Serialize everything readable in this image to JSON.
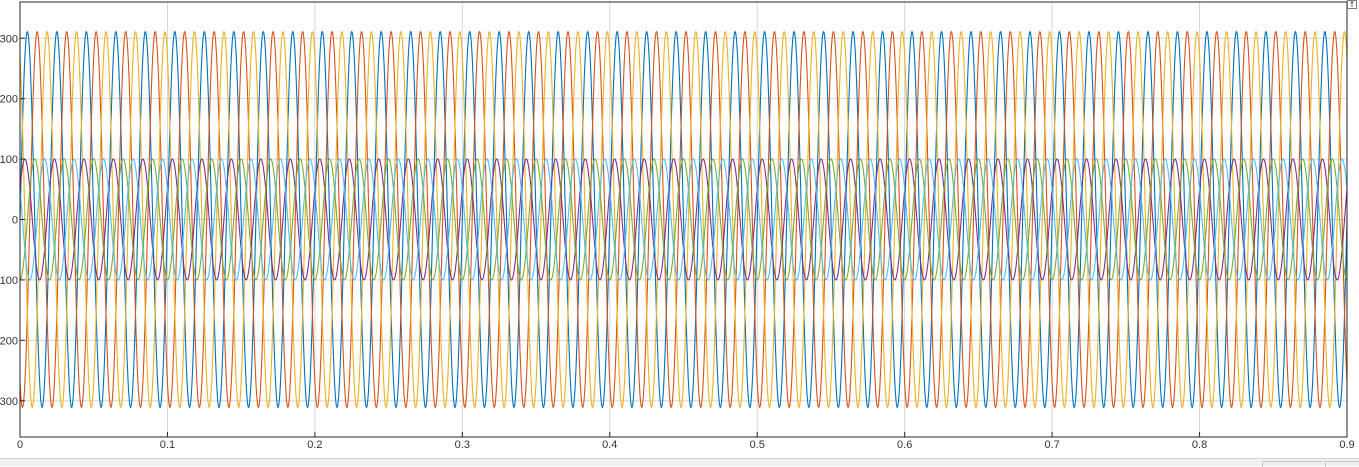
{
  "icons": {
    "axes_restore": "arrow-up-icon"
  },
  "colors": {
    "background": "#ffffff",
    "axes_border": "#262626",
    "grid": "#d6d6d6",
    "tick_label": "#333333"
  },
  "chart_data": {
    "type": "line",
    "title": "",
    "xlabel": "",
    "ylabel": "",
    "xlim": [
      0,
      0.9
    ],
    "ylim": [
      -360,
      360
    ],
    "grid": true,
    "legend": "none",
    "x_ticks": [
      "0",
      "0.1",
      "0.2",
      "0.3",
      "0.4",
      "0.5",
      "0.6",
      "0.7",
      "0.8",
      "0.9"
    ],
    "y_ticks": [
      "300",
      "200",
      "100",
      "0",
      "100",
      "200",
      "300"
    ],
    "y_tick_values": [
      300,
      200,
      100,
      0,
      -100,
      -200,
      -300
    ],
    "frequency_hz": 50,
    "series": [
      {
        "color": "#0072bd",
        "amplitude": 311,
        "phase_deg": 0
      },
      {
        "color": "#d95319",
        "amplitude": 311,
        "phase_deg": -120
      },
      {
        "color": "#edb120",
        "amplitude": 311,
        "phase_deg": 120
      },
      {
        "color": "#7e2f8e",
        "amplitude": 100,
        "phase_deg": 30
      },
      {
        "color": "#77ac30",
        "amplitude": 100,
        "phase_deg": -90
      },
      {
        "color": "#4dbeee",
        "amplitude": 100,
        "phase_deg": 150
      }
    ]
  }
}
